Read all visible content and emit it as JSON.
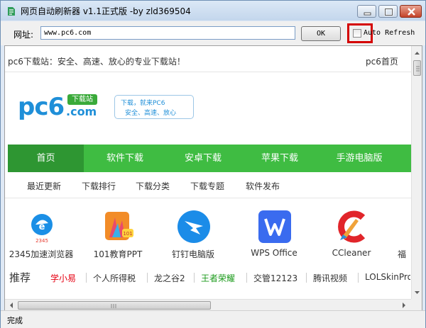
{
  "window": {
    "title": "网页自动刷新器 v1.1正式版 -by zld369504"
  },
  "toolbar": {
    "address_label": "网址:",
    "address_value": "www.pc6.com",
    "ok_label": "OK",
    "auto_refresh_label": "Auto Refresh",
    "auto_refresh_checked": false
  },
  "page": {
    "slogan": "pc6下载站：安全、高速、放心的专业下载站！",
    "home_link": "pc6首页",
    "logo": {
      "main": "pc6",
      "badge": "下载站",
      "suffix": ".com",
      "bubble_line1": "下载，就来PC6",
      "bubble_line2": "安全、高速、放心"
    },
    "nav": [
      "首页",
      "软件下载",
      "安卓下载",
      "苹果下载",
      "手游电脑版"
    ],
    "subnav": [
      "最近更新",
      "下载排行",
      "下载分类",
      "下载专题",
      "软件发布"
    ],
    "apps": [
      {
        "name": "2345加速浏览器",
        "icon": "2345-browser-icon"
      },
      {
        "name": "101教育PPT",
        "icon": "101-ppt-icon"
      },
      {
        "name": "钉钉电脑版",
        "icon": "dingtalk-icon"
      },
      {
        "name": "WPS Office",
        "icon": "wps-office-icon"
      },
      {
        "name": "CCleaner",
        "icon": "ccleaner-icon"
      },
      {
        "name": "福",
        "icon": ""
      }
    ],
    "recommend": {
      "title": "推荐",
      "items": [
        {
          "label": "学小易",
          "color": "#e60012"
        },
        {
          "label": "个人所得税",
          "color": "#333333"
        },
        {
          "label": "龙之谷2",
          "color": "#333333"
        },
        {
          "label": "王者荣耀",
          "color": "#1a9a1a"
        },
        {
          "label": "交管12123",
          "color": "#333333"
        },
        {
          "label": "腾讯视频",
          "color": "#333333"
        },
        {
          "label": "LOLSkinPro",
          "color": "#333333"
        }
      ]
    }
  },
  "status": {
    "text": "完成"
  },
  "colors": {
    "nav_green": "#3fbc42",
    "nav_active": "#2e9632",
    "highlight_red": "#d40000",
    "logo_blue": "#1f8fd8"
  }
}
